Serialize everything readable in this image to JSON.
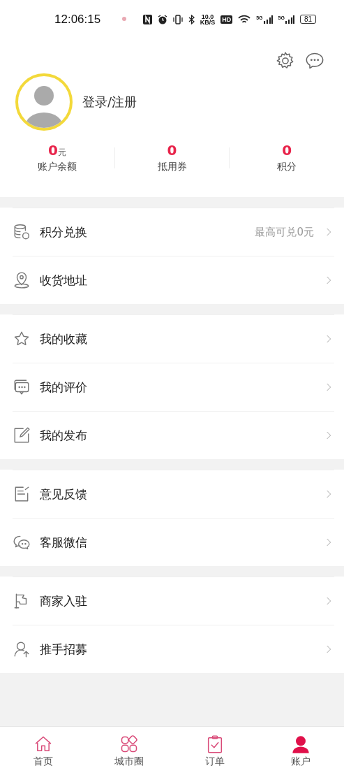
{
  "status_bar": {
    "time": "12:06:15",
    "speed_value": "10.0",
    "speed_unit": "KB/S",
    "hd": "HD",
    "sim_1": "5G",
    "sim_2": "5G",
    "battery": "81"
  },
  "profile": {
    "login_label": "登录/注册"
  },
  "stats": [
    {
      "value": "0",
      "unit": "元",
      "label": "账户余额"
    },
    {
      "value": "0",
      "label": "抵用券"
    },
    {
      "value": "0",
      "label": "积分"
    }
  ],
  "menu_groups": [
    [
      {
        "kind": "coins",
        "label": "积分兑换",
        "value": "最高可兑0元"
      },
      {
        "kind": "location",
        "label": "收货地址"
      }
    ],
    [
      {
        "kind": "star",
        "label": "我的收藏"
      },
      {
        "kind": "comment",
        "label": "我的评价"
      },
      {
        "kind": "edit",
        "label": "我的发布"
      }
    ],
    [
      {
        "kind": "note",
        "label": "意见反馈"
      },
      {
        "kind": "chat",
        "label": "客服微信"
      }
    ],
    [
      {
        "kind": "flag",
        "label": "商家入驻"
      },
      {
        "kind": "person",
        "label": "推手招募"
      }
    ]
  ],
  "tabs": [
    {
      "kind": "home",
      "label": "首页",
      "selected": false
    },
    {
      "kind": "grid",
      "label": "城市圈",
      "selected": false
    },
    {
      "kind": "clipboard",
      "label": "订单",
      "selected": false
    },
    {
      "kind": "user",
      "label": "账户",
      "selected": true
    }
  ]
}
